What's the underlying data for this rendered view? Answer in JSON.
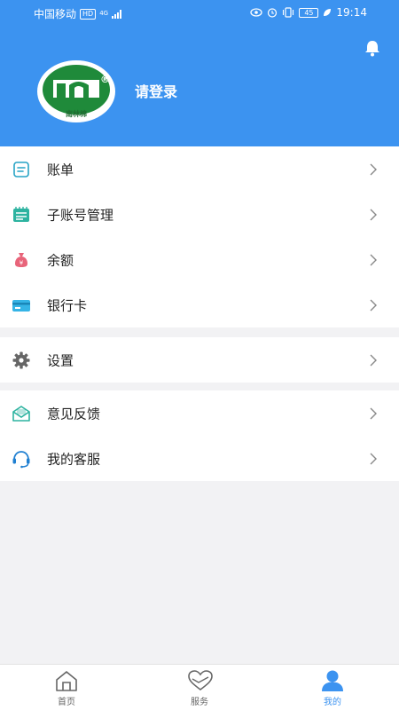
{
  "status_bar": {
    "carrier": "中国移动",
    "hd_badge": "HD",
    "network": "4G",
    "battery": "45",
    "battery_level": 0.45,
    "time": "19:14"
  },
  "header": {
    "logo_text": "南林棉",
    "registered_mark": "®",
    "login_prompt": "请登录",
    "background_color": "#3c93f0"
  },
  "menu": {
    "group1": [
      {
        "label": "账单",
        "icon": "bill-icon"
      },
      {
        "label": "子账号管理",
        "icon": "sub-account-icon"
      },
      {
        "label": "余额",
        "icon": "balance-icon"
      },
      {
        "label": "银行卡",
        "icon": "bank-card-icon"
      }
    ],
    "group2": [
      {
        "label": "设置",
        "icon": "gear-icon"
      }
    ],
    "group3": [
      {
        "label": "意见反馈",
        "icon": "feedback-icon"
      },
      {
        "label": "我的客服",
        "icon": "customer-service-icon"
      }
    ]
  },
  "tabbar": {
    "tabs": [
      {
        "label": "首页",
        "icon": "home-icon",
        "active": false
      },
      {
        "label": "服务",
        "icon": "heart-icon",
        "active": false
      },
      {
        "label": "我的",
        "icon": "user-icon",
        "active": true
      }
    ],
    "active_color": "#3c93f0"
  }
}
